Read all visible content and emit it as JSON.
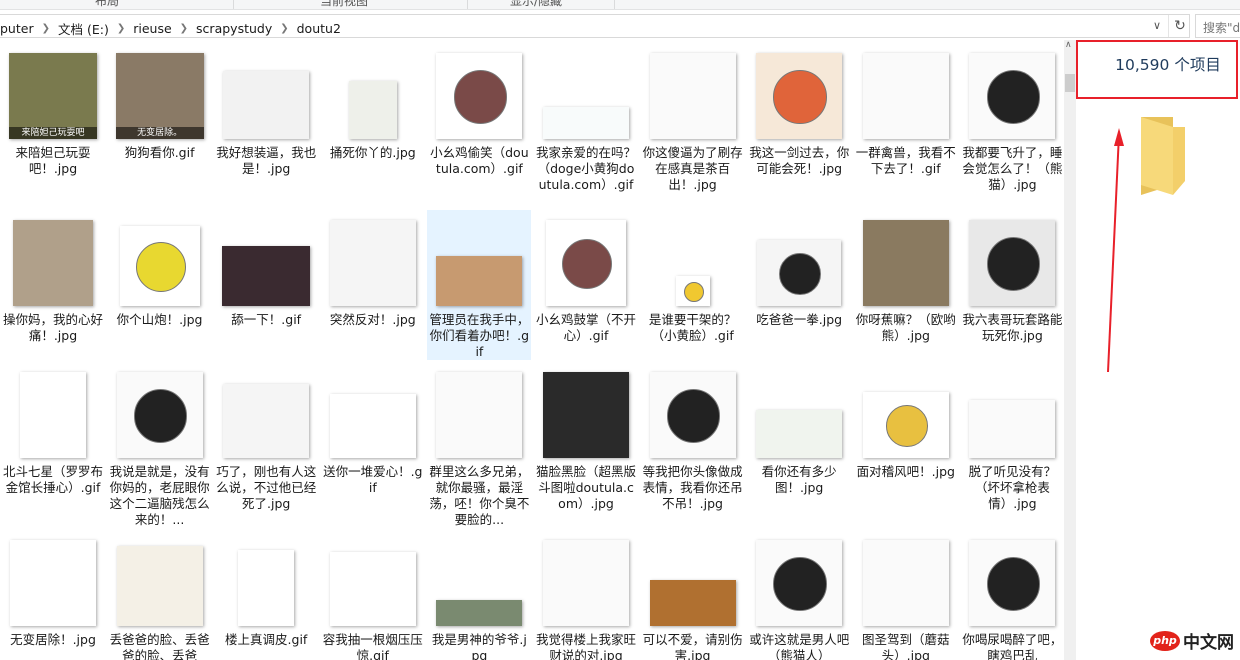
{
  "ribbon": {
    "sections": [
      "布局",
      "当前视图",
      "显示/隐藏"
    ]
  },
  "address": {
    "crumbs": [
      "puter",
      "文档 (E:)",
      "rieuse",
      "scrapystudy",
      "doutu2"
    ],
    "search_placeholder": "搜索\"d"
  },
  "details": {
    "item_count": "10,590 个项目"
  },
  "watermark": {
    "logo": "php",
    "text": "中文网"
  },
  "files": [
    {
      "label": "来陪妲己玩耍吧！.jpg",
      "thumb": "#7a7a4e",
      "caption": "来陪妲己玩耍吧",
      "w": 88,
      "h": 86
    },
    {
      "label": "狗狗看你.gif",
      "thumb": "#8a7a66",
      "caption": "无变居除。",
      "w": 88,
      "h": 86
    },
    {
      "label": "我好想装逼，我也是！.jpg",
      "thumb": "#f2f2f2",
      "w": 86,
      "h": 68
    },
    {
      "label": "捅死你丫的.jpg",
      "thumb": "#eef0ea",
      "w": 48,
      "h": 58
    },
    {
      "label": "小幺鸡偷笑（doutula.com）.gif",
      "thumb": "#fff",
      "w": 86,
      "h": 86,
      "face": "#7a4a48"
    },
    {
      "label": "我家亲爱的在吗？（doge小黄狗doutula.com）.gif",
      "thumb": "#f8fbfb",
      "w": 86,
      "h": 32
    },
    {
      "label": "你这傻逼为了刷存在感真是茶百出！.jpg",
      "thumb": "#fafafa",
      "w": 86,
      "h": 86
    },
    {
      "label": "我这一剑过去，你可能会死！.jpg",
      "thumb": "#f6e8d8",
      "w": 86,
      "h": 86,
      "face": "#e0643a"
    },
    {
      "label": "一群禽兽，我看不下去了！.gif",
      "thumb": "#fafafa",
      "w": 86,
      "h": 86
    },
    {
      "label": "我都要飞升了，睡会觉怎么了！（熊猫）.jpg",
      "thumb": "#fafafa",
      "w": 86,
      "h": 86,
      "face": "#222"
    },
    {
      "label": "操你妈，我的心好痛！.jpg",
      "thumb": "#b0a08a",
      "w": 80,
      "h": 86
    },
    {
      "label": "你个山炮！.jpg",
      "thumb": "#fff",
      "w": 80,
      "h": 80,
      "face": "#e8d830"
    },
    {
      "label": "舔一下！.gif",
      "thumb": "#3a2a30",
      "w": 88,
      "h": 60
    },
    {
      "label": "突然反对！.jpg",
      "thumb": "#f5f5f5",
      "w": 86,
      "h": 86
    },
    {
      "label": "管理员在我手中，你们看着办吧！.gif",
      "thumb": "#c79a70",
      "w": 86,
      "h": 50,
      "selected": true
    },
    {
      "label": "小幺鸡鼓掌（不开心）.gif",
      "thumb": "#fff",
      "w": 80,
      "h": 86,
      "face": "#7a4a48"
    },
    {
      "label": "是谁要干架的？（小黄脸）.gif",
      "thumb": "#fff",
      "w": 34,
      "h": 30,
      "face": "#f0c830"
    },
    {
      "label": "吃爸爸一拳.jpg",
      "thumb": "#f5f5f5",
      "w": 84,
      "h": 66,
      "face": "#222"
    },
    {
      "label": "你呀蕉嘛？（欧哟熊）.jpg",
      "thumb": "#8a7a60",
      "w": 86,
      "h": 86
    },
    {
      "label": "我六表哥玩套路能玩死你.jpg",
      "thumb": "#e8e8e8",
      "w": 86,
      "h": 86,
      "face": "#222"
    },
    {
      "label": "北斗七星（罗罗布金馆长捶心）.gif",
      "thumb": "#fff",
      "w": 66,
      "h": 86
    },
    {
      "label": "我说是就是，没有你妈的，老屁眼你这个二逼脑残怎么来的！...",
      "thumb": "#fafafa",
      "w": 86,
      "h": 86,
      "face": "#222"
    },
    {
      "label": "巧了，刚也有人这么说，不过他已经死了.jpg",
      "thumb": "#f5f5f5",
      "w": 86,
      "h": 74
    },
    {
      "label": "送你一堆爱心！.gif",
      "thumb": "#fff",
      "w": 86,
      "h": 64
    },
    {
      "label": "群里这么多兄弟，就你最骚，最淫荡，呸！你个臭不要脸的...",
      "thumb": "#fafafa",
      "w": 86,
      "h": 86
    },
    {
      "label": "猫脸黑脸（超黑版斗图啦doutula.com）.jpg",
      "thumb": "#2a2a2a",
      "w": 86,
      "h": 86
    },
    {
      "label": "等我把你头像做成表情，我看你还吊不吊！.jpg",
      "thumb": "#fafafa",
      "w": 86,
      "h": 86,
      "face": "#222"
    },
    {
      "label": "看你还有多少图！.jpg",
      "thumb": "#f0f4ee",
      "w": 86,
      "h": 48
    },
    {
      "label": "面对稽风吧！.jpg",
      "thumb": "#fff",
      "w": 86,
      "h": 66,
      "face": "#e8c040"
    },
    {
      "label": "脱了听见没有？（坏坏拿枪表情）.jpg",
      "thumb": "#fafafa",
      "w": 86,
      "h": 58
    },
    {
      "label": "无变居除！.jpg",
      "thumb": "#fff",
      "w": 86,
      "h": 86
    },
    {
      "label": "丢爸爸的脸、丢爸爸的脸、丢爸",
      "thumb": "#f4f0e6",
      "w": 86,
      "h": 80
    },
    {
      "label": "楼上真调皮.gif",
      "thumb": "#fff",
      "w": 56,
      "h": 76
    },
    {
      "label": "容我抽一根烟压压惊.gif",
      "thumb": "#fff",
      "w": 86,
      "h": 74
    },
    {
      "label": "我是男神的爷爷.jpg",
      "thumb": "#7a8a70",
      "w": 86,
      "h": 26
    },
    {
      "label": "我觉得楼上我家旺财说的对.jpg",
      "thumb": "#fafafa",
      "w": 86,
      "h": 86
    },
    {
      "label": "可以不爱，请别伤害.jpg",
      "thumb": "#b07030",
      "w": 86,
      "h": 46
    },
    {
      "label": "或许这就是男人吧（熊猫人）",
      "thumb": "#fafafa",
      "w": 86,
      "h": 86,
      "face": "#222"
    },
    {
      "label": "图圣驾到（蘑菇头）.jpg",
      "thumb": "#fafafa",
      "w": 86,
      "h": 86
    },
    {
      "label": "你喝尿喝醉了吧，瞎鸡巴乱",
      "thumb": "#fafafa",
      "w": 86,
      "h": 86,
      "face": "#222"
    }
  ]
}
